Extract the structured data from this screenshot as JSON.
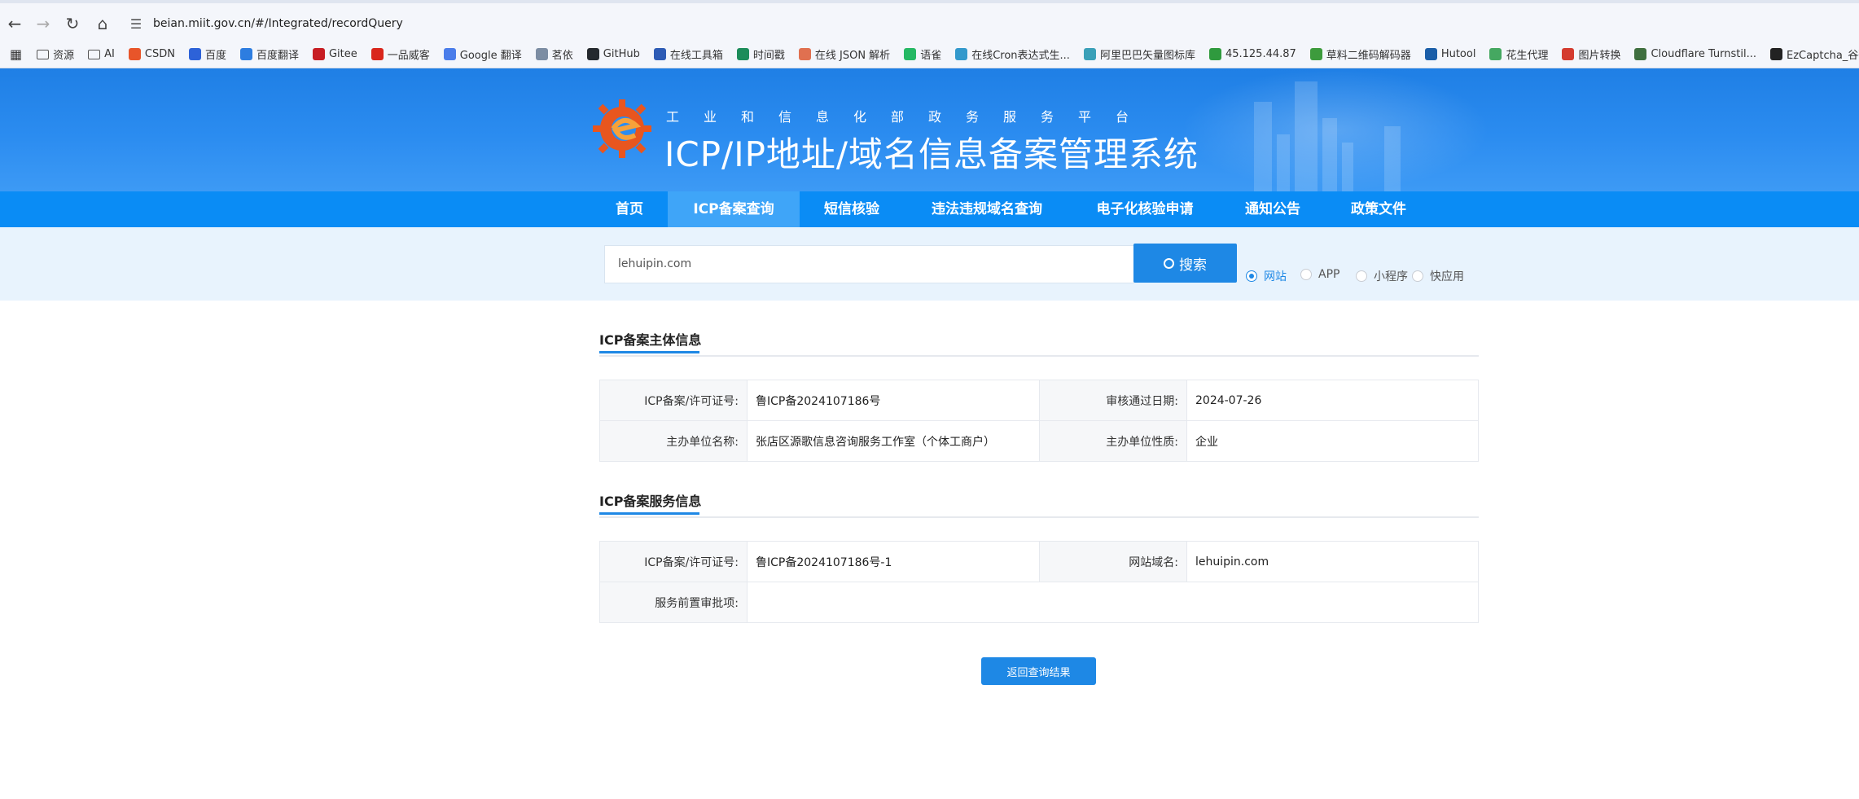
{
  "browser": {
    "url": "beian.miit.gov.cn/#/Integrated/recordQuery",
    "bookmarks": [
      {
        "label": "资源",
        "color": "transparent"
      },
      {
        "label": "AI",
        "color": "transparent"
      },
      {
        "label": "CSDN",
        "color": "#e8552a"
      },
      {
        "label": "百度",
        "color": "#2d62d8"
      },
      {
        "label": "百度翻译",
        "color": "#2d7de0"
      },
      {
        "label": "Gitee",
        "color": "#c71d23"
      },
      {
        "label": "一品威客",
        "color": "#d9261c"
      },
      {
        "label": "Google 翻译",
        "color": "#4a7dea"
      },
      {
        "label": "茗依",
        "color": "#7c8da3"
      },
      {
        "label": "GitHub",
        "color": "#24292e"
      },
      {
        "label": "在线工具箱",
        "color": "#2d5bb5"
      },
      {
        "label": "时间戳",
        "color": "#1c8c5a"
      },
      {
        "label": "在线 JSON 解析",
        "color": "#e07050"
      },
      {
        "label": "语雀",
        "color": "#25b864"
      },
      {
        "label": "在线Cron表达式生...",
        "color": "#3399cc"
      },
      {
        "label": "阿里巴巴矢量图标库",
        "color": "#3aa0b8"
      },
      {
        "label": "45.125.44.87",
        "color": "#2f9a3e"
      },
      {
        "label": "草料二维码解码器",
        "color": "#3d9b3d"
      },
      {
        "label": "Hutool",
        "color": "#1b5ea8"
      },
      {
        "label": "花生代理",
        "color": "#45a861"
      },
      {
        "label": "图片转换",
        "color": "#d43b2f"
      },
      {
        "label": "Cloudflare Turnstil...",
        "color": "#3f6f3f"
      },
      {
        "label": "EzCaptcha_谷歌验...",
        "color": "#222222"
      }
    ]
  },
  "header": {
    "subtitle": "工业和信息化部政务服务平台",
    "title": "ICP/IP地址/域名信息备案管理系统"
  },
  "nav": {
    "items": [
      {
        "label": "首页",
        "active": false
      },
      {
        "label": "ICP备案查询",
        "active": true
      },
      {
        "label": "短信核验",
        "active": false
      },
      {
        "label": "违法违规域名查询",
        "active": false
      },
      {
        "label": "电子化核验申请",
        "active": false
      },
      {
        "label": "通知公告",
        "active": false
      },
      {
        "label": "政策文件",
        "active": false
      }
    ]
  },
  "search": {
    "value": "lehuipin.com",
    "button_label": "搜索",
    "options": [
      {
        "label": "网站",
        "checked": true
      },
      {
        "label": "APP",
        "checked": false
      },
      {
        "label": "小程序",
        "checked": false
      },
      {
        "label": "快应用",
        "checked": false
      }
    ]
  },
  "subject_info": {
    "title": "ICP备案主体信息",
    "license_label": "ICP备案/许可证号:",
    "license_value": "鲁ICP备2024107186号",
    "approve_label": "审核通过日期:",
    "approve_value": "2024-07-26",
    "org_label": "主办单位名称:",
    "org_value": "张店区源歌信息咨询服务工作室（个体工商户）",
    "nature_label": "主办单位性质:",
    "nature_value": "企业"
  },
  "service_info": {
    "title": "ICP备案服务信息",
    "license_label": "ICP备案/许可证号:",
    "license_value": "鲁ICP备2024107186号-1",
    "domain_label": "网站域名:",
    "domain_value": "lehuipin.com",
    "preapproval_label": "服务前置审批项:",
    "preapproval_value": ""
  },
  "back_button_label": "返回查询结果",
  "colors": {
    "primary": "#1e88e5",
    "nav_bg": "#0a8cf5",
    "nav_active": "#3fa5f8",
    "banner": "#2b8cf0"
  }
}
